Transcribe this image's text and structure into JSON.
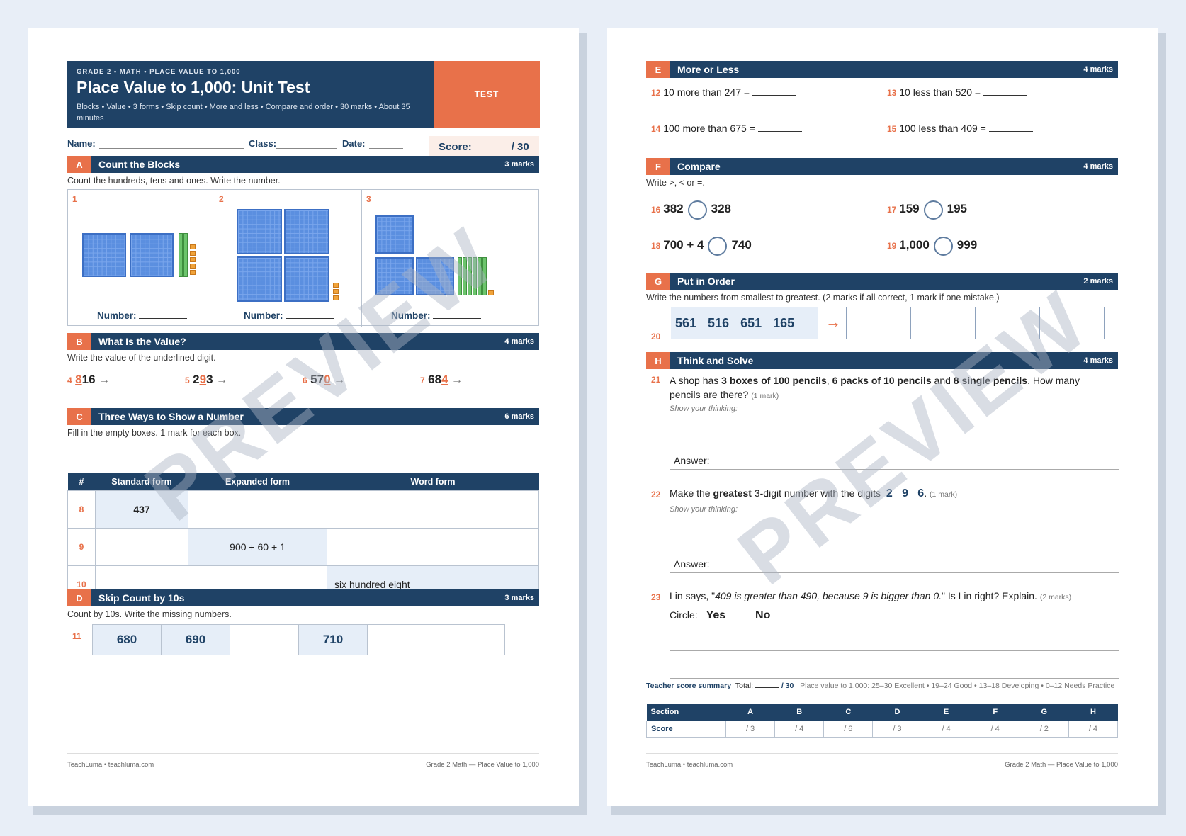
{
  "header": {
    "kicker": "GRADE 2  •  MATH  •  PLACE VALUE TO 1,000",
    "title": "Place Value to 1,000: Unit Test",
    "meta": "Blocks  •  Value  •  3 forms  •  Skip count  •  More and less  •  Compare and order  •  30 marks  •  About 35 minutes",
    "tag": "TEST"
  },
  "info": {
    "name": "Name:",
    "class": "Class:",
    "date": "Date:",
    "score": "Score:",
    "score_total": "/ 30"
  },
  "watermark": "PREVIEW",
  "sectionA": {
    "letter": "A",
    "name": "Count the Blocks",
    "marks": "3 marks",
    "instruction": "Count the hundreds, tens and ones. Write the number.",
    "panels": [
      {
        "n": "1",
        "label": "Number:"
      },
      {
        "n": "2",
        "label": "Number:"
      },
      {
        "n": "3",
        "label": "Number:"
      }
    ]
  },
  "sectionB": {
    "letter": "B",
    "name": "What Is the Value?",
    "marks": "4 marks",
    "instruction": "Write the value of the underlined digit.",
    "items": [
      {
        "n": "4",
        "pre": "",
        "u": "8",
        "post": "16"
      },
      {
        "n": "5",
        "pre": "2",
        "u": "9",
        "post": "3"
      },
      {
        "n": "6",
        "pre": "57",
        "u": "0",
        "post": ""
      },
      {
        "n": "7",
        "pre": "68",
        "u": "4",
        "post": ""
      }
    ],
    "arrow": "→"
  },
  "sectionC": {
    "letter": "C",
    "name": "Three Ways to Show a Number",
    "marks": "6 marks",
    "instruction": "Fill in the empty boxes. 1 mark for each box.",
    "headers": [
      "#",
      "Standard form",
      "Expanded form",
      "Word form"
    ],
    "rows": [
      [
        "8",
        "437",
        "",
        ""
      ],
      [
        "9",
        "",
        "900 + 60 + 1",
        ""
      ],
      [
        "10",
        "",
        "",
        "six hundred eight"
      ]
    ]
  },
  "sectionD": {
    "letter": "D",
    "name": "Skip Count by 10s",
    "marks": "3 marks",
    "instruction": "Count by 10s. Write the missing numbers.",
    "n": "11",
    "cells": [
      "680",
      "690",
      "",
      "710",
      "",
      ""
    ]
  },
  "footer": {
    "left": "TeachLuma  •  teachluma.com",
    "right": "Grade 2 Math — Place Value to 1,000"
  },
  "sectionE": {
    "letter": "E",
    "name": "More or Less",
    "marks": "4 marks",
    "items": [
      {
        "n": "12",
        "text": "10 more than 247  ="
      },
      {
        "n": "13",
        "text": "10 less than 520  ="
      },
      {
        "n": "14",
        "text": "100 more than 675  ="
      },
      {
        "n": "15",
        "text": "100 less than 409  ="
      }
    ]
  },
  "sectionF": {
    "letter": "F",
    "name": "Compare",
    "marks": "4 marks",
    "instruction": "Write >, < or =.",
    "items": [
      {
        "n": "16",
        "a": "382",
        "b": "328"
      },
      {
        "n": "17",
        "a": "159",
        "b": "195"
      },
      {
        "n": "18",
        "a": "700 + 4",
        "b": "740"
      },
      {
        "n": "19",
        "a": "1,000",
        "b": "999"
      }
    ]
  },
  "sectionG": {
    "letter": "G",
    "name": "Put in Order",
    "marks": "2 marks",
    "instruction": "Write the numbers from smallest to greatest. (2 marks if all correct, 1 mark if one mistake.)",
    "n": "20",
    "numbers": [
      "561",
      "516",
      "651",
      "165"
    ],
    "arrow": "→"
  },
  "sectionH": {
    "letter": "H",
    "name": "Think and Solve",
    "marks": "4 marks",
    "q21": {
      "n": "21",
      "t1": "A shop has ",
      "b1": "3 boxes of 100 pencils",
      "t2": ", ",
      "b2": "6 packs of 10 pencils",
      "t3": " and ",
      "b3": "8 single pencils",
      "t4": ". How many",
      "line2": "pencils are there?",
      "mark": "(1 mark)",
      "show": "Show your thinking:",
      "answer": "Answer:"
    },
    "q22": {
      "n": "22",
      "t1": "Make the ",
      "b1": "greatest",
      "t2": " 3-digit number with the digits",
      "digits": "2   9   6",
      "dot": ".",
      "mark": "(1 mark)",
      "show": "Show your thinking:",
      "answer": "Answer:"
    },
    "q23": {
      "n": "23",
      "t1": "Lin says, \"",
      "it": "409 is greater than 490, because 9 is bigger than 0.",
      "t2": "\" Is Lin right? Explain.",
      "mark": "(2 marks)",
      "circle": "Circle:",
      "yes": "Yes",
      "no": "No"
    }
  },
  "summary": {
    "title": "Teacher score summary",
    "total": "Total:",
    "total_of": "/ 30",
    "scale": "Place value to 1,000: 25–30 Excellent • 19–24 Good • 13–18 Developing • 0–12 Needs Practice",
    "headers": [
      "Section",
      "A",
      "B",
      "C",
      "D",
      "E",
      "F",
      "G",
      "H"
    ],
    "row": [
      "Score",
      "/ 3",
      "/ 4",
      "/ 6",
      "/ 3",
      "/ 4",
      "/ 4",
      "/ 2",
      "/ 4"
    ]
  }
}
